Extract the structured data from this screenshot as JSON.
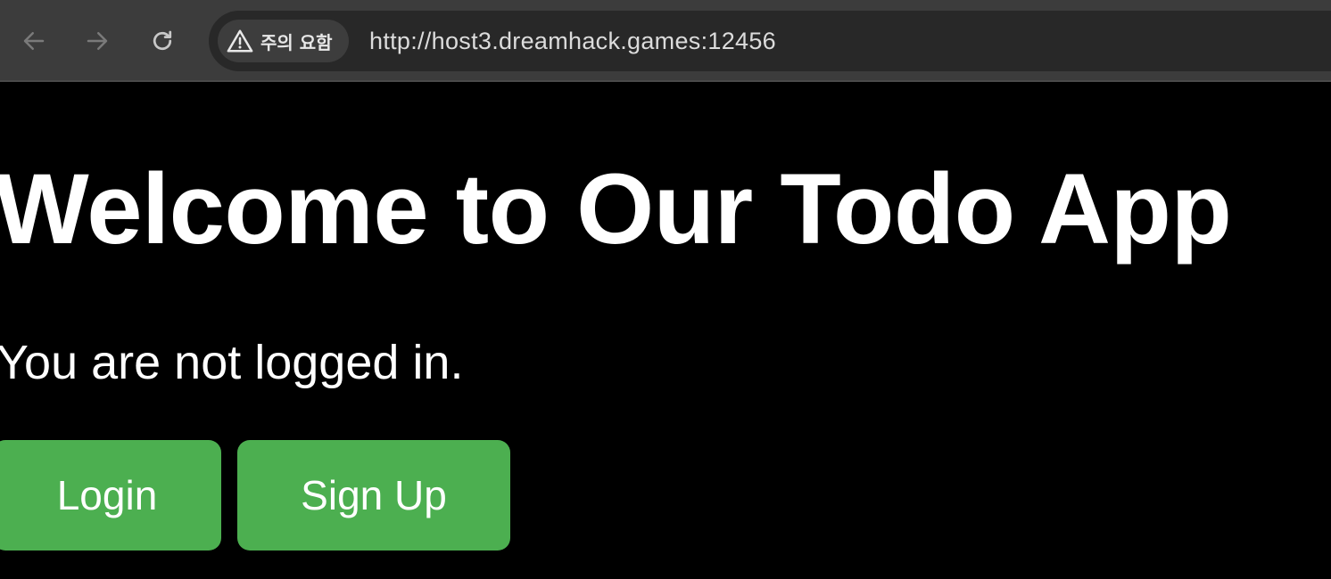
{
  "browser": {
    "back_icon": "arrow-left-icon",
    "forward_icon": "arrow-right-icon",
    "reload_icon": "reload-icon",
    "security_chip": {
      "icon": "warning-triangle-icon",
      "label": "주의 요함"
    },
    "url": "http://host3.dreamhack.games:12456"
  },
  "page": {
    "title": "Welcome to Our Todo App",
    "status_message": "You are not logged in.",
    "buttons": {
      "login_label": "Login",
      "signup_label": "Sign Up"
    }
  },
  "colors": {
    "page_background": "#000000",
    "toolbar_background": "#3c3c3c",
    "omnibox_background": "#282828",
    "button_green": "#4caf50",
    "text_white": "#ffffff"
  }
}
